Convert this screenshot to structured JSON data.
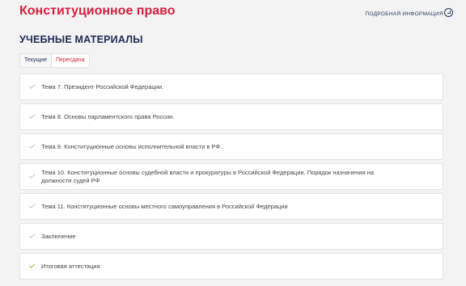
{
  "header": {
    "course_title": "Конституционное право",
    "info_link": "ПОДРОБНАЯ ИНФОРМАЦИЯ"
  },
  "section": {
    "title": "УЧЕБНЫЕ МАТЕРИАЛЫ"
  },
  "tabs": [
    {
      "label": "Текущие"
    },
    {
      "label": "Пересдача"
    }
  ],
  "materials": [
    {
      "label": "Тема 7. Президент Российской Федерации.",
      "completed": false
    },
    {
      "label": "Тема 8. Основы парламентского права России.",
      "completed": false
    },
    {
      "label": "Тема 9. Конституционные основы исполнительной власти в РФ.",
      "completed": false
    },
    {
      "label": "Тема 10. Конституционные основы судебной власти и прокуратуры в Российской Федерации. Порядок назначения на должности судей РФ",
      "completed": false
    },
    {
      "label": "Тема 11. Конституционные основы местного самоуправления в Российской Федерации",
      "completed": false
    },
    {
      "label": "Заключение",
      "completed": false
    },
    {
      "label": "Итоговая аттестация",
      "completed": true
    }
  ],
  "colors": {
    "brand_red": "#d81f3f",
    "navy": "#1f2a55",
    "check_done": "#9bc44a",
    "check_pending": "#c8c8c8"
  }
}
